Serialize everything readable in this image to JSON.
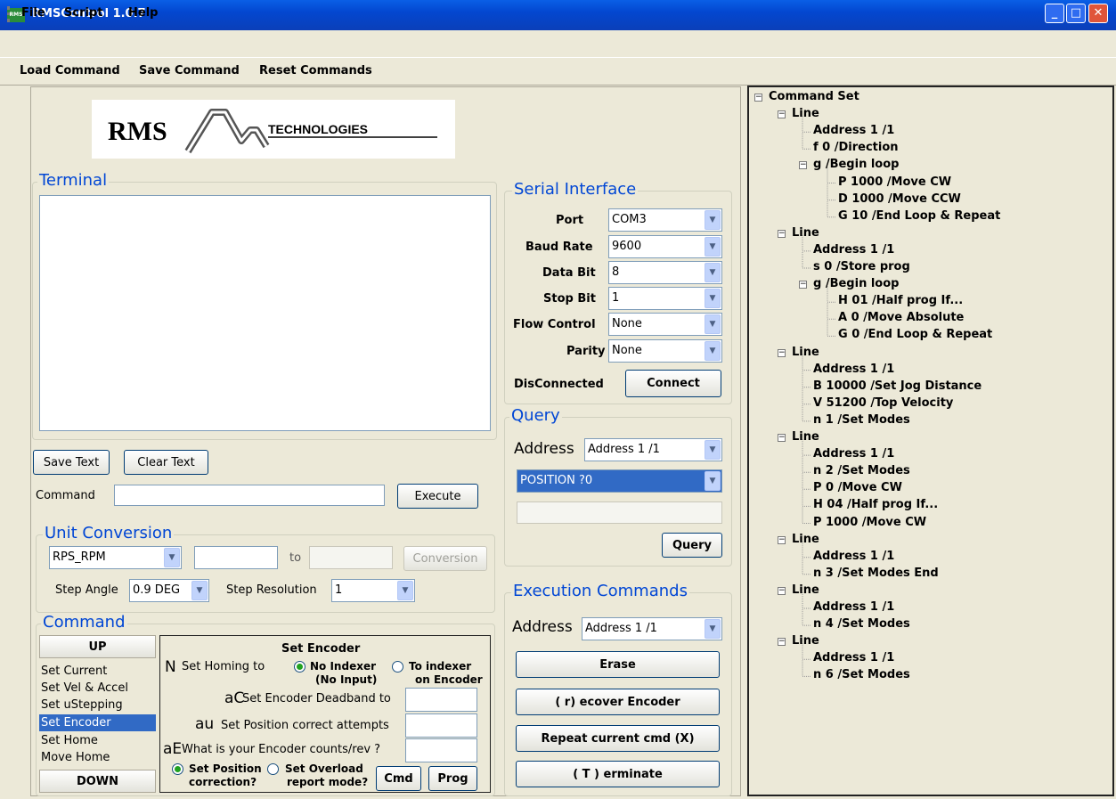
{
  "window": {
    "title": "RMSControl 1.0.7",
    "icon": "RMS"
  },
  "menu": [
    "File",
    "Script",
    "Help"
  ],
  "toolbar": [
    "Load Command",
    "Save Command",
    "Reset Commands"
  ],
  "logo": {
    "text_left": "RMS",
    "text_right": "TECHNOLOGIES"
  },
  "terminal": {
    "title": "Terminal",
    "save_label": "Save Text",
    "clear_label": "Clear Text",
    "command_label": "Command",
    "command_value": "",
    "execute_label": "Execute"
  },
  "unit_conversion": {
    "title": "Unit Conversion",
    "unit": "RPS_RPM",
    "input": "",
    "to_label": "to",
    "output": "",
    "conversion_label": "Conversion",
    "step_angle_label": "Step Angle",
    "step_angle": "0.9 DEG",
    "step_res_label": "Step Resolution",
    "step_res": "1"
  },
  "command": {
    "title": "Command",
    "up": "UP",
    "down": "DOWN",
    "items": [
      "Set Current",
      "Set Vel & Accel",
      "Set uStepping",
      "Set Encoder",
      "Set Home",
      "Move Home"
    ],
    "selected": 3
  },
  "encoder": {
    "title": "Set Encoder",
    "n_code": "N",
    "homing_label": "Set Homing to",
    "opt1": "No Indexer",
    "opt1b": "(No Input)",
    "opt2": "To indexer",
    "opt2b": "on Encoder",
    "ac_code": "aC",
    "ac_label": "Set Encoder Deadband to",
    "au_code": "au",
    "au_label": "Set Position correct attempts",
    "ae_code": "aE",
    "ae_label": "What is your Encoder counts/rev ?",
    "pos_label": "Set Position",
    "pos_label2": "correction?",
    "over_label": "Set Overload",
    "over_label2": "report mode?",
    "cmd_label": "Cmd",
    "prog_label": "Prog"
  },
  "serial": {
    "title": "Serial Interface",
    "port_label": "Port",
    "port": "COM3",
    "baud_label": "Baud Rate",
    "baud": "9600",
    "data_label": "Data Bit",
    "data": "8",
    "stop_label": "Stop Bit",
    "stop": "1",
    "flow_label": "Flow Control",
    "flow": "None",
    "parity_label": "Parity",
    "parity": "None",
    "status": "DisConnected",
    "connect_label": "Connect"
  },
  "query": {
    "title": "Query",
    "address_label": "Address",
    "address": "Address 1 /1",
    "command": "POSITION ?0",
    "result": "",
    "query_label": "Query"
  },
  "execution": {
    "title": "Execution Commands",
    "address_label": "Address",
    "address": "Address 1 /1",
    "erase": "Erase",
    "recover": "( r) ecover Encoder",
    "repeat": "Repeat current cmd (X)",
    "terminate": "( T ) erminate"
  },
  "tree": [
    {
      "text": "Command Set",
      "level": 0,
      "toggle": "⊟"
    },
    {
      "text": "Line",
      "level": 1,
      "toggle": "⊟"
    },
    {
      "text": "Address 1 /1",
      "level": 2
    },
    {
      "text": "f 0 /Direction",
      "level": 2
    },
    {
      "text": "g /Begin loop",
      "level": 2,
      "toggle": "⊟"
    },
    {
      "text": "P 1000 /Move CW",
      "level": 3
    },
    {
      "text": "D 1000 /Move CCW",
      "level": 3
    },
    {
      "text": "G 10 /End Loop & Repeat",
      "level": 3
    },
    {
      "text": "Line",
      "level": 1,
      "toggle": "⊟"
    },
    {
      "text": "Address 1 /1",
      "level": 2
    },
    {
      "text": "s 0 /Store prog",
      "level": 2
    },
    {
      "text": "g /Begin loop",
      "level": 2,
      "toggle": "⊟"
    },
    {
      "text": "H 01 /Half prog If...",
      "level": 3
    },
    {
      "text": "A 0 /Move Absolute",
      "level": 3
    },
    {
      "text": "G 0 /End Loop & Repeat",
      "level": 3
    },
    {
      "text": "Line",
      "level": 1,
      "toggle": "⊟"
    },
    {
      "text": "Address 1 /1",
      "level": 2
    },
    {
      "text": "B 10000 /Set Jog Distance",
      "level": 2
    },
    {
      "text": "V 51200 /Top Velocity",
      "level": 2
    },
    {
      "text": "n 1 /Set Modes",
      "level": 2
    },
    {
      "text": "Line",
      "level": 1,
      "toggle": "⊟"
    },
    {
      "text": "Address 1 /1",
      "level": 2
    },
    {
      "text": "n 2 /Set Modes",
      "level": 2
    },
    {
      "text": "P 0 /Move CW",
      "level": 2
    },
    {
      "text": "H 04 /Half prog If...",
      "level": 2
    },
    {
      "text": "P 1000 /Move CW",
      "level": 2
    },
    {
      "text": "Line",
      "level": 1,
      "toggle": "⊟"
    },
    {
      "text": "Address 1 /1",
      "level": 2
    },
    {
      "text": "n 3 /Set Modes End",
      "level": 2
    },
    {
      "text": "Line",
      "level": 1,
      "toggle": "⊟"
    },
    {
      "text": "Address 1 /1",
      "level": 2
    },
    {
      "text": "n 4 /Set Modes",
      "level": 2
    },
    {
      "text": "Line",
      "level": 1,
      "toggle": "⊟"
    },
    {
      "text": "Address 1 /1",
      "level": 2
    },
    {
      "text": "n 6 /Set Modes",
      "level": 2
    }
  ]
}
